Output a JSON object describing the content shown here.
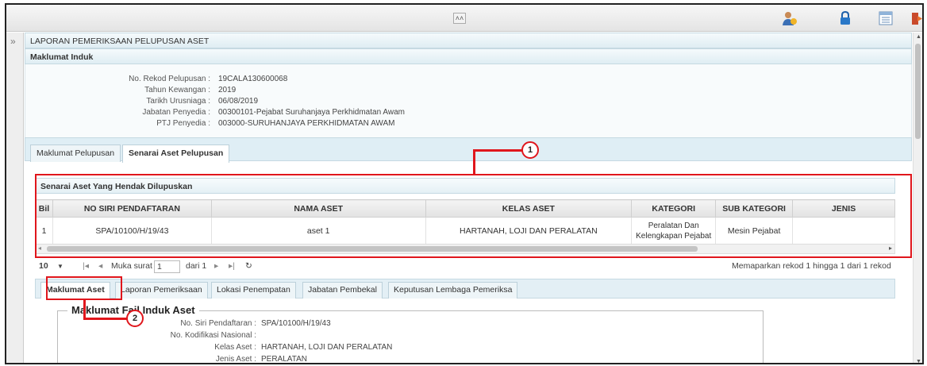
{
  "icons": {
    "collapse": "double-chevron-up-icon",
    "sidebar": "double-chevron-right-icon",
    "user": "user-help-icon",
    "lock": "lock-icon",
    "list": "list-icon",
    "exit": "exit-icon"
  },
  "page_title": "LAPORAN PEMERIKSAAN PELUPUSAN ASET",
  "induk": {
    "title": "Maklumat Induk",
    "fields": [
      {
        "label": "No. Rekod Pelupusan :",
        "value": "19CALA130600068"
      },
      {
        "label": "Tahun Kewangan :",
        "value": "2019"
      },
      {
        "label": "Tarikh Urusniaga :",
        "value": "06/08/2019"
      },
      {
        "label": "Jabatan Penyedia :",
        "value": "00300101-Pejabat Suruhanjaya Perkhidmatan Awam"
      },
      {
        "label": "PTJ Penyedia :",
        "value": "003000-SURUHANJAYA PERKHIDMATAN AWAM"
      }
    ]
  },
  "tabs": [
    {
      "label": "Maklumat Pelupusan"
    },
    {
      "label": "Senarai Aset Pelupusan"
    }
  ],
  "senarai": {
    "title": "Senarai Aset Yang Hendak Dilupuskan",
    "columns": [
      "Bil",
      "NO SIRI PENDAFTARAN",
      "NAMA ASET",
      "KELAS ASET",
      "KATEGORI",
      "SUB KATEGORI",
      "JENIS"
    ],
    "rows": [
      {
        "bil": "1",
        "no_siri": "SPA/10100/H/19/43",
        "nama": "aset 1",
        "kelas": "HARTANAH, LOJI DAN PERALATAN",
        "kategori_1": "Peralatan Dan",
        "kategori_2": "Kelengkapan Pejabat",
        "sub": "Mesin Pejabat",
        "jenis": ""
      }
    ]
  },
  "pager": {
    "page_size": "10",
    "page_label": "Muka surat",
    "page_value": "1",
    "of_label": "dari 1",
    "summary": "Memaparkan rekod 1 hingga 1 dari 1 rekod"
  },
  "subtabs": [
    {
      "label": "Maklumat Aset"
    },
    {
      "label": "Laporan Pemeriksaan"
    },
    {
      "label": "Lokasi Penempatan"
    },
    {
      "label": "Jabatan Pembekal"
    },
    {
      "label": "Keputusan Lembaga Pemeriksa"
    }
  ],
  "aset": {
    "legend": "Maklumat Fail Induk Aset",
    "fields": [
      {
        "label": "No. Siri Pendaftaran :",
        "value": "SPA/10100/H/19/43"
      },
      {
        "label": "No. Kodifikasi Nasional :",
        "value": ""
      },
      {
        "label": "Kelas Aset :",
        "value": "HARTANAH, LOJI DAN PERALATAN"
      },
      {
        "label": "Jenis Aset :",
        "value": "PERALATAN"
      }
    ]
  },
  "callouts": [
    "1",
    "2"
  ],
  "colors": {
    "highlight": "#e0161c",
    "header_bg": "#dfedf3"
  }
}
